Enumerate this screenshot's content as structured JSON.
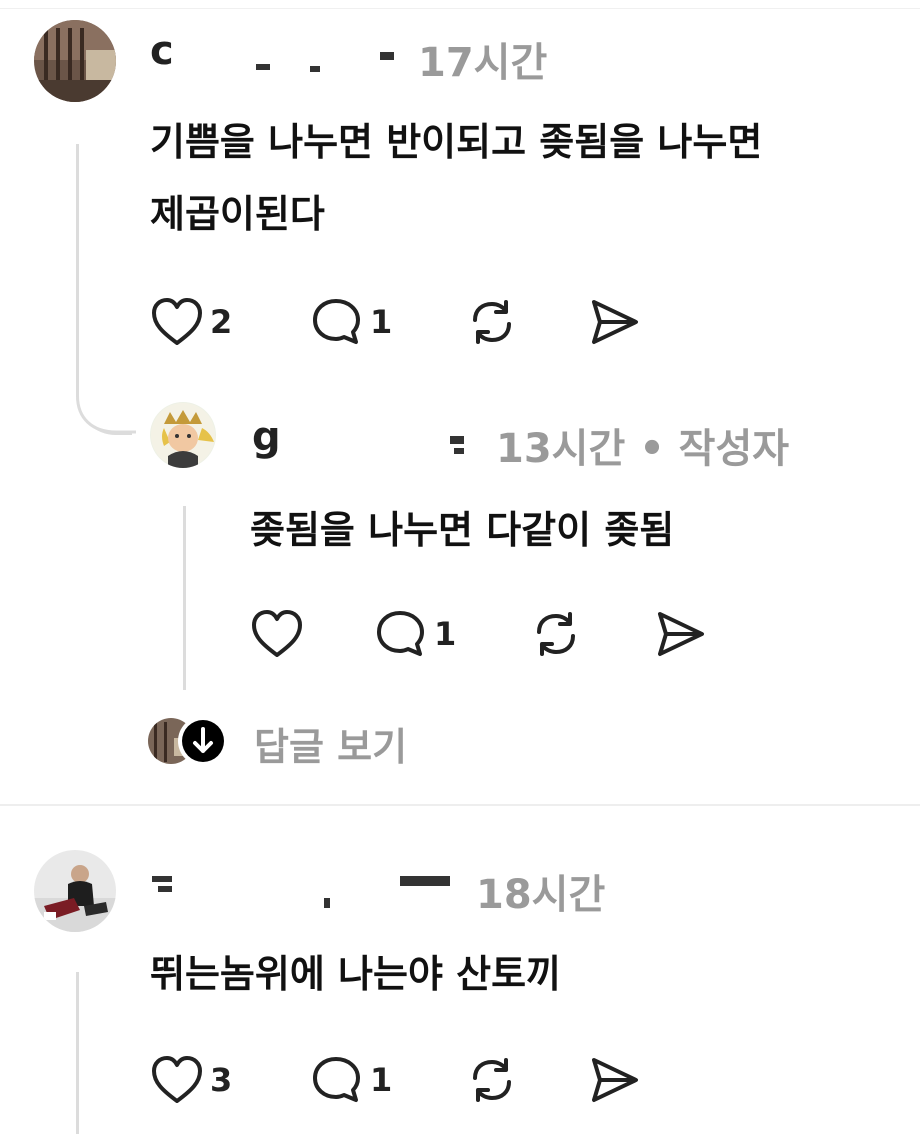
{
  "comments": [
    {
      "username": "c",
      "time": "17시간",
      "text_lines": [
        "기쁨을 나누면 반이되고 좆됨을 나누면",
        "제곱이된다"
      ],
      "likes": "2",
      "replies": "1"
    },
    {
      "username": "g",
      "time": "13시간 • 작성자",
      "text_lines": [
        "좆됨을 나누면 다같이 좆됨"
      ],
      "likes": "",
      "replies": "1"
    },
    {
      "username": "",
      "time": "18시간",
      "text_lines": [
        "뛰는놈위에 나는야 산토끼"
      ],
      "likes": "3",
      "replies": "1"
    }
  ],
  "view_replies_label": "답글 보기",
  "icons": {
    "like": "heart-icon",
    "reply": "speech-bubble-icon",
    "repost": "repost-icon",
    "share": "send-icon",
    "expand": "arrow-down-icon"
  }
}
